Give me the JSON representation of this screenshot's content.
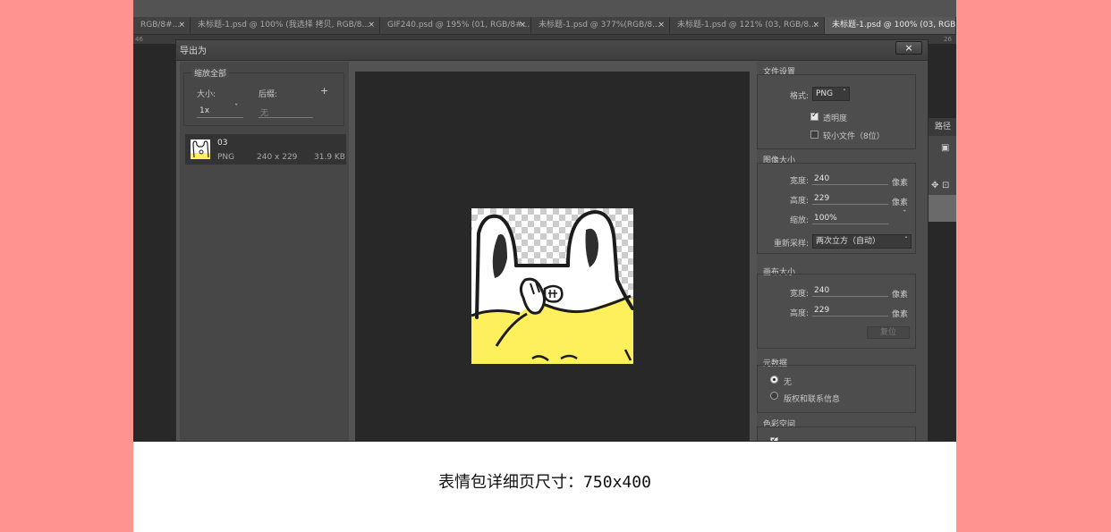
{
  "tabs": [
    {
      "label": "RGB/8#...",
      "close": "×"
    },
    {
      "label": "未标题-1.psd @ 100% (我选择 拷贝, RGB/8...",
      "close": "×"
    },
    {
      "label": "GIF240.psd @ 195% (01, RGB/8#...",
      "close": "×"
    },
    {
      "label": "未标题-1.psd @ 377%(RGB/8...",
      "close": "×"
    },
    {
      "label": "未标题-1.psd @ 121% (03, RGB/8...",
      "close": "×"
    },
    {
      "label": "未标题-1.psd @ 100% (03, RGB/8...",
      "close": "×"
    }
  ],
  "ruler": {
    "left": "46",
    "right": "26"
  },
  "right_panel": {
    "tab": "路径"
  },
  "dialog": {
    "title": "导出为",
    "close": "×",
    "scale_group": {
      "legend": "缩放全部",
      "size_label": "大小:",
      "suffix_label": "后缀:",
      "size_value": "1x",
      "suffix_placeholder": "无",
      "add": "+"
    },
    "asset": {
      "name": "03",
      "format": "PNG",
      "dimensions": "240 x 229",
      "filesize": "31.9 KB"
    },
    "file_settings": {
      "title": "文件设置",
      "format_label": "格式:",
      "format_value": "PNG",
      "transparency_label": "透明度",
      "transparency_checked": true,
      "smaller_file_label": "较小文件（8位）",
      "smaller_file_checked": false
    },
    "image_size": {
      "title": "图像大小",
      "width_label": "宽度:",
      "width_value": "240",
      "height_label": "高度:",
      "height_value": "229",
      "scale_label": "缩放:",
      "scale_value": "100%",
      "unit": "像素",
      "resample_label": "重新采样:",
      "resample_value": "两次立方（自动）"
    },
    "canvas_size": {
      "title": "画布大小",
      "width_label": "宽度:",
      "width_value": "240",
      "height_label": "高度:",
      "height_value": "229",
      "unit": "像素",
      "reset_label": "复位"
    },
    "metadata": {
      "title": "元数据",
      "option_none": "无",
      "option_copyright": "版权和联系信息",
      "selected": "无"
    },
    "color_space": {
      "title": "色彩空间"
    }
  },
  "caption": "表情包详细页尺寸：750x400",
  "colors": {
    "background": "#ff9390",
    "sweater": "#fef05c",
    "ps_panel": "#535353",
    "preview": "#282828"
  }
}
